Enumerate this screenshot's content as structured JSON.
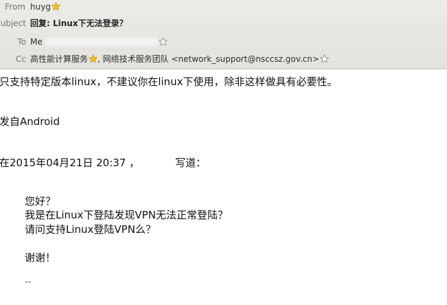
{
  "header": {
    "from_label": "From",
    "from_value": "huyg",
    "subject_label": "ubject",
    "subject_value": "回复: Linux下无法登录？",
    "to_label": "To",
    "to_value": "Me",
    "cc_label": "Cc",
    "cc_value_1": "高性能计算服务",
    "cc_value_2": ", 网络技术服务团队 <network_support@nsccsz.gov.cn>"
  },
  "body": {
    "line_1": "只支持特定版本linux，不建议你在linux下使用，除非这样做具有必要性。",
    "line_2": "发自Android",
    "line_3_start": "在2015年04月21日 20:37 ，",
    "line_3_end": "写道：",
    "quote_1": "您好？",
    "quote_2": "我是在Linux下登陆发现VPN无法正常登陆？",
    "quote_3": "请问支持Linux登陆VPN么？",
    "quote_4": "谢谢！",
    "quote_5": "--"
  },
  "colors": {
    "header_bg": "#e8e6e2",
    "label": "#777672",
    "star_filled": "#f2c318",
    "star_outline": "#9a9894"
  },
  "icons": {
    "from_star": "star-filled-icon",
    "to_star": "star-outline-icon",
    "cc_star_1": "star-filled-icon",
    "cc_star_2": "star-outline-icon"
  }
}
